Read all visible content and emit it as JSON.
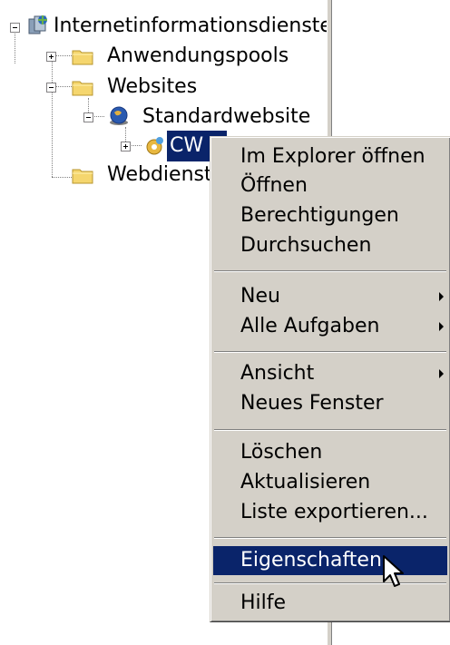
{
  "tree": {
    "items": [
      {
        "label": "Internetinformationsdienste"
      },
      {
        "label": "Anwendungspools"
      },
      {
        "label": "Websites"
      },
      {
        "label": "Standardwebsite"
      },
      {
        "label": "CW"
      },
      {
        "label": "Webdienste"
      }
    ]
  },
  "context_menu": {
    "items": [
      {
        "label": "Im Explorer öffnen"
      },
      {
        "label": "Öffnen"
      },
      {
        "label": "Berechtigungen"
      },
      {
        "label": "Durchsuchen"
      },
      {
        "label": "Neu"
      },
      {
        "label": "Alle Aufgaben"
      },
      {
        "label": "Ansicht"
      },
      {
        "label": "Neues Fenster"
      },
      {
        "label": "Löschen"
      },
      {
        "label": "Aktualisieren"
      },
      {
        "label": "Liste exportieren..."
      },
      {
        "label": "Eigenschaften"
      },
      {
        "label": "Hilfe"
      }
    ]
  },
  "colors": {
    "selection": "#0a246a",
    "menu_bg": "#d4d0c8"
  },
  "icons": [
    "iis-server-icon",
    "folder-icon",
    "globe-icon",
    "gear-icon",
    "arrow-cursor-icon"
  ]
}
